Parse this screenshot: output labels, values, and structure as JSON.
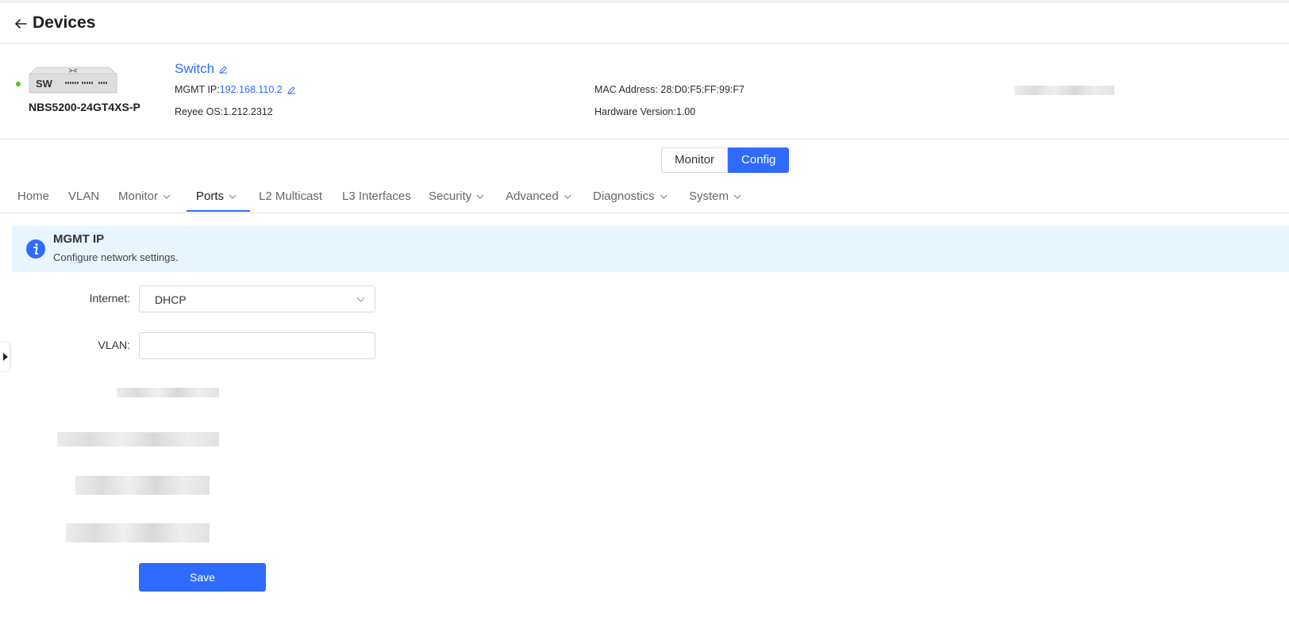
{
  "header": {
    "title": "Devices"
  },
  "device": {
    "badge": "SW",
    "model": "NBS5200-24GT4XS-P",
    "name": "Switch",
    "mgmt_ip_label": "MGMT IP:",
    "mgmt_ip": "192.168.110.2",
    "os": "Reyee OS:1.212.2312",
    "mac": "MAC Address: 28:D0:F5:FF:99:F7",
    "hardware": "Hardware Version:1.00",
    "status_color": "#52c41a"
  },
  "mode": {
    "monitor": "Monitor",
    "config": "Config"
  },
  "nav": [
    {
      "label": "Home"
    },
    {
      "label": "VLAN"
    },
    {
      "label": "Monitor"
    },
    {
      "label": "Ports"
    },
    {
      "label": "L2 Multicast"
    },
    {
      "label": "L3 Interfaces"
    },
    {
      "label": "Security"
    },
    {
      "label": "Advanced"
    },
    {
      "label": "Diagnostics"
    },
    {
      "label": "System"
    }
  ],
  "banner": {
    "title": "MGMT IP",
    "description": "Configure network settings."
  },
  "form": {
    "internet_label": "Internet:",
    "internet_value": "DHCP",
    "vlan_label": "VLAN:",
    "vlan_value": "",
    "save_label": "Save"
  },
  "colors": {
    "accent": "#2f6bff",
    "banner_bg": "#e8f4fe"
  }
}
